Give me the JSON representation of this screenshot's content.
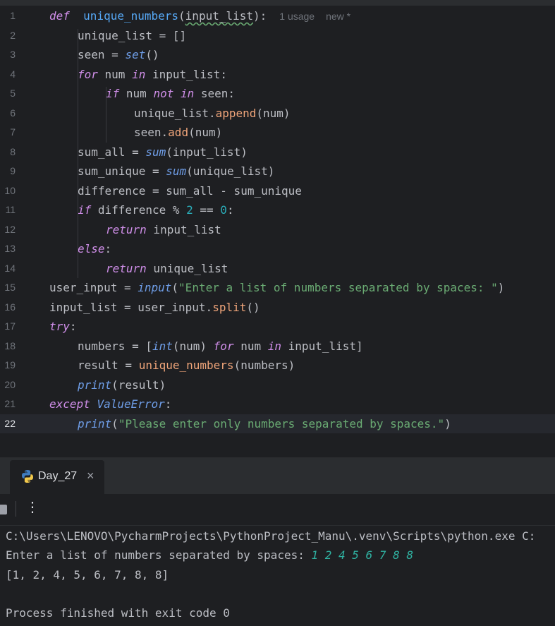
{
  "editor": {
    "inlay_usage": "1 usage",
    "inlay_new": "new *",
    "lines": [
      {
        "n": "1",
        "indent": 0,
        "tokens": [
          [
            "kw",
            "def"
          ],
          [
            "",
            "  "
          ],
          [
            "fnname",
            "unique_numbers"
          ],
          [
            "",
            "("
          ],
          [
            "param",
            "input_list"
          ],
          [
            "",
            "):"
          ]
        ],
        "inlay": true
      },
      {
        "n": "2",
        "indent": 1,
        "tokens": [
          [
            "",
            "unique_list = []"
          ]
        ]
      },
      {
        "n": "3",
        "indent": 1,
        "tokens": [
          [
            "",
            "seen = "
          ],
          [
            "bi",
            "set"
          ],
          [
            "",
            "()"
          ]
        ]
      },
      {
        "n": "4",
        "indent": 1,
        "tokens": [
          [
            "kw",
            "for"
          ],
          [
            "",
            " num "
          ],
          [
            "kw",
            "in"
          ],
          [
            "",
            "",
            " "
          ],
          [
            "",
            "input_list:"
          ]
        ]
      },
      {
        "n": "5",
        "indent": 2,
        "tokens": [
          [
            "kw",
            "if"
          ],
          [
            "",
            "",
            " num "
          ],
          [
            "kw",
            "not in"
          ],
          [
            "",
            "",
            " seen:"
          ]
        ]
      },
      {
        "n": "6",
        "indent": 3,
        "tokens": [
          [
            "",
            "unique_list."
          ],
          [
            "call",
            "append"
          ],
          [
            "",
            "(num)"
          ]
        ]
      },
      {
        "n": "7",
        "indent": 3,
        "tokens": [
          [
            "",
            "seen."
          ],
          [
            "call",
            "add"
          ],
          [
            "",
            "(num)"
          ]
        ]
      },
      {
        "n": "8",
        "indent": 1,
        "tokens": [
          [
            "",
            "sum_all = "
          ],
          [
            "bi",
            "sum"
          ],
          [
            "",
            "(input_list)"
          ]
        ]
      },
      {
        "n": "9",
        "indent": 1,
        "tokens": [
          [
            "",
            "sum_unique = "
          ],
          [
            "bi",
            "sum"
          ],
          [
            "",
            "(unique_list)"
          ]
        ]
      },
      {
        "n": "10",
        "indent": 1,
        "tokens": [
          [
            "",
            "difference = sum_all - sum_unique"
          ]
        ]
      },
      {
        "n": "11",
        "indent": 1,
        "tokens": [
          [
            "kw",
            "if"
          ],
          [
            "",
            "",
            " difference % "
          ],
          [
            "num",
            "2"
          ],
          [
            "",
            "",
            " == "
          ],
          [
            "num",
            "0"
          ],
          [
            "",
            ":"
          ]
        ]
      },
      {
        "n": "12",
        "indent": 2,
        "tokens": [
          [
            "kw",
            "return"
          ],
          [
            "",
            "",
            " input_list"
          ]
        ]
      },
      {
        "n": "13",
        "indent": 1,
        "tokens": [
          [
            "kw",
            "else"
          ],
          [
            "",
            ":"
          ]
        ]
      },
      {
        "n": "14",
        "indent": 2,
        "tokens": [
          [
            "kw",
            "return"
          ],
          [
            "",
            "",
            " unique_list"
          ]
        ]
      },
      {
        "n": "15",
        "indent": 0,
        "tokens": [
          [
            "",
            "user_input = "
          ],
          [
            "bi",
            "input"
          ],
          [
            "",
            "("
          ],
          [
            "str",
            "\"Enter a list of numbers separated by spaces: \""
          ],
          [
            "",
            ")"
          ]
        ]
      },
      {
        "n": "16",
        "indent": 0,
        "tokens": [
          [
            "",
            "input_list = user_input."
          ],
          [
            "call",
            "split"
          ],
          [
            "",
            "()"
          ]
        ]
      },
      {
        "n": "17",
        "indent": 0,
        "tokens": [
          [
            "kw",
            "try"
          ],
          [
            "",
            ":"
          ]
        ]
      },
      {
        "n": "18",
        "indent": 1,
        "tokens": [
          [
            "",
            "numbers = ["
          ],
          [
            "bi",
            "int"
          ],
          [
            "",
            "(num) "
          ],
          [
            "kw",
            "for"
          ],
          [
            "",
            "",
            " num "
          ],
          [
            "kw",
            "in"
          ],
          [
            "",
            "",
            " input_list]"
          ]
        ]
      },
      {
        "n": "19",
        "indent": 1,
        "tokens": [
          [
            "",
            "result = "
          ],
          [
            "call",
            "unique_numbers"
          ],
          [
            "",
            "(numbers)"
          ]
        ]
      },
      {
        "n": "20",
        "indent": 1,
        "tokens": [
          [
            "bi",
            "print"
          ],
          [
            "",
            "(result)"
          ]
        ]
      },
      {
        "n": "21",
        "indent": 0,
        "tokens": [
          [
            "kw",
            "except"
          ],
          [
            "",
            "",
            " "
          ],
          [
            "bi",
            "ValueError"
          ],
          [
            "",
            ":"
          ]
        ]
      },
      {
        "n": "22",
        "indent": 1,
        "tokens": [
          [
            "bi",
            "print"
          ],
          [
            "",
            "("
          ],
          [
            "str",
            "\"Please enter only numbers separated by spaces.\""
          ],
          [
            "",
            ")"
          ]
        ],
        "current": true
      }
    ]
  },
  "run_panel": {
    "tab_title": "Day_27",
    "close_glyph": "×",
    "more_glyph": "⋮"
  },
  "console": {
    "line1": "C:\\Users\\LENOVO\\PycharmProjects\\PythonProject_Manu\\.venv\\Scripts\\python.exe C:",
    "line2_prompt": "Enter a list of numbers separated by spaces: ",
    "line2_input": "1 2 4 5 6 7 8 8",
    "line3": "[1, 2, 4, 5, 6, 7, 8, 8]",
    "line5": "Process finished with exit code 0"
  },
  "colors": {
    "background": "#1e1f22",
    "keyword": "#cf8ee8",
    "string": "#6aab73",
    "number": "#2aacb8",
    "function": "#56a8f5",
    "call": "#f0a57a"
  }
}
